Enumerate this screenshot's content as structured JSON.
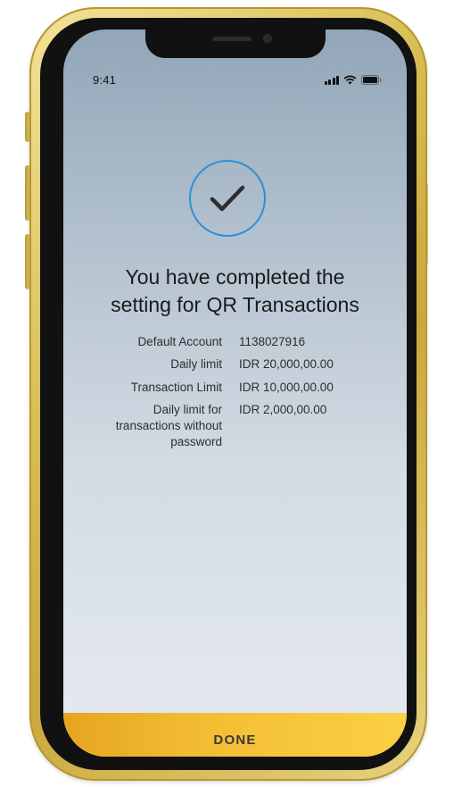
{
  "status_bar": {
    "time": "9:41"
  },
  "confirmation": {
    "icon": "checkmark-icon",
    "accent_color": "#2f8ed6",
    "title_line_1": "You have completed the",
    "title_line_2": "setting for QR Transactions"
  },
  "details": [
    {
      "label": "Default Account",
      "value": "1138027916"
    },
    {
      "label": "Daily limit",
      "value": "IDR 20,000,00.00"
    },
    {
      "label": "Transaction Limit",
      "value": "IDR 10,000,00.00"
    },
    {
      "label": "Daily limit for transactions without password",
      "value": "IDR 2,000,00.00"
    }
  ],
  "actions": {
    "done_label": "DONE",
    "done_color": "#f3bd33"
  }
}
